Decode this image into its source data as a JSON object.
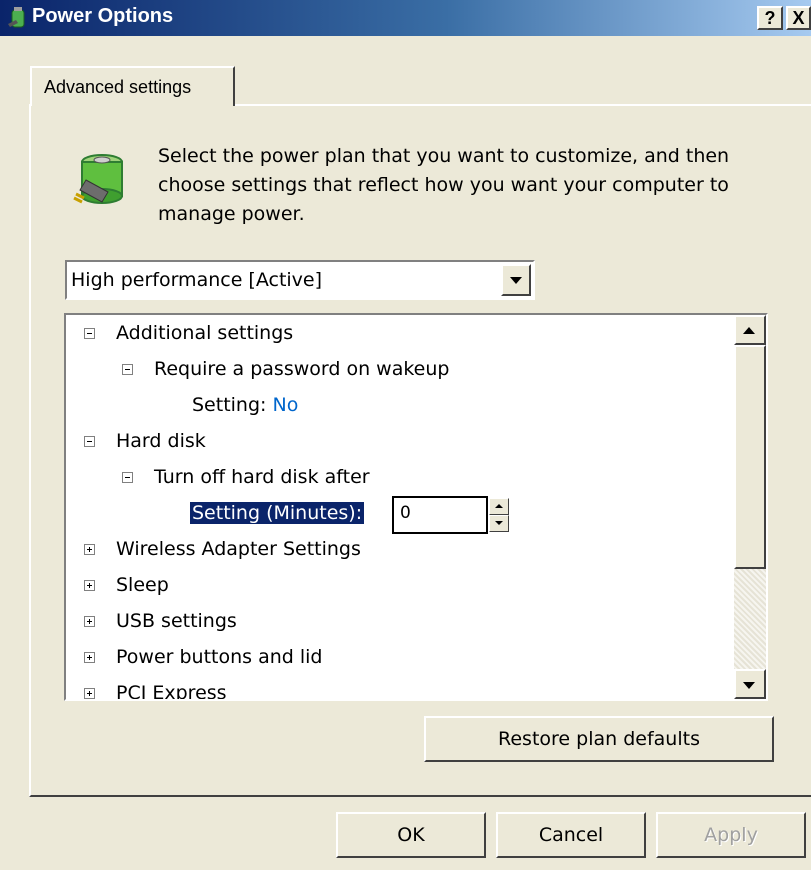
{
  "window": {
    "title": "Power Options",
    "help_button": "?",
    "close_button": "X"
  },
  "tabs": [
    {
      "label": "Advanced settings",
      "selected": true
    }
  ],
  "description": "Select the power plan that you want to customize, and then choose settings that reflect how you want your computer to manage power.",
  "plan_select": {
    "value": "High performance [Active]"
  },
  "tree": {
    "items": [
      {
        "label": "Additional settings",
        "expanded": true
      },
      {
        "label": "Require a password on wakeup",
        "expanded": true
      },
      {
        "label": "Setting:",
        "value": "No"
      },
      {
        "label": "Hard disk",
        "expanded": true
      },
      {
        "label": "Turn off hard disk after",
        "expanded": true
      },
      {
        "label": "Setting (Minutes):",
        "value": "0"
      },
      {
        "label": "Wireless Adapter Settings",
        "expanded": false
      },
      {
        "label": "Sleep",
        "expanded": false
      },
      {
        "label": "USB settings",
        "expanded": false
      },
      {
        "label": "Power buttons and lid",
        "expanded": false
      },
      {
        "label": "PCI Express",
        "expanded": false
      }
    ]
  },
  "buttons": {
    "restore": "Restore plan defaults",
    "ok": "OK",
    "cancel": "Cancel",
    "apply": "Apply"
  },
  "colors": {
    "titlebar_start": "#0a246a",
    "titlebar_end": "#a6caf0",
    "dialog_face": "#ece9d8",
    "value_link": "#0066cc",
    "selection": "#0a246a"
  }
}
